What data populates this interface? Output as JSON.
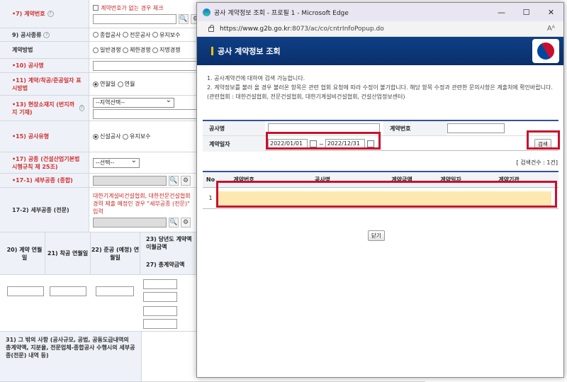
{
  "form": {
    "contract_no_label": "•7) 계약번호",
    "contract_no_chk": "계약번호가 없는 경우 체크",
    "type_label": "9) 공사종류",
    "type_opts": [
      "종합공사",
      "전문공사",
      "유지보수"
    ],
    "method_label": "계약방법",
    "method_opts": [
      "일반경쟁",
      "제한경쟁",
      "지명경쟁"
    ],
    "name_label": "•10) 공사명",
    "date_label": "•11) 계약/착공/준공일자 표시방법",
    "date_opts": [
      "연월일",
      "연월"
    ],
    "loc_label": "•13) 현장소재지 (번지까지 기재)",
    "loc_select": "--지역선택--",
    "ctype_label": "•15) 공사유형",
    "ctype_opts": [
      "신설공사",
      "유지보수"
    ],
    "work_label": "•17) 공종 (건설산업기본법 시행규칙 제 25조)",
    "work_select": "--선택--",
    "sub1_label": "•17-1) 세부공종 (종합)",
    "sub2_label": "17-2) 세부공종 (전문)",
    "sub2_note": "대한기계설비건설협회, 대한전문건설협회 경력 제출 예정인 경우 \"세부공종 (전문)\" 입력",
    "c20": "20) 계약 연월일",
    "c21": "21) 착공 연월일",
    "c22": "22) 준공 (예정) 연월일",
    "c23": "23) 당년도 계약액 이월금액",
    "c27": "27) 총계약금액",
    "c31": "31) 그 밖의 사항 (공사규모, 공법, 공동도급내역의 총계약액, 지분율, 전문업체-종합공사 수행시의 세부공종(전문) 내역 등)"
  },
  "popup": {
    "title": "공사 계약정보 조회 - 프로필 1 - Microsoft Edge",
    "url": "https://www.g2b.go.kr:8073/ac/co/cntrInfoPopup.do",
    "url_host": "https://www.g2b.go.kr",
    "url_rest": ":8073/ac/co/cntrInfoPopup.do",
    "header": "공사 계약정보 조회",
    "notice1": "1. 공사계약건에 대하여 검색 가능합니다.",
    "notice2": "2. 계약정보를 불러 올 경우 불러온 항목은 관련 협회 요청에 따라 수정이 불가합니다. 해당 항목 수정과 관련한 문의사항은 계출처에 확인바랍니다. (관련협회 : 대한건설협회, 전문건설협회, 대한기계설비건설협회, 건설산업정보센터)",
    "lbl_name": "공사명",
    "lbl_no": "계약번호",
    "lbl_date": "계약일자",
    "date_from": "2022/01/01",
    "date_to": "2022/12/31",
    "tilde": "~",
    "search_btn": "검색",
    "count": "[ 검색건수 : 1건]",
    "cols": [
      "No",
      "계약번호",
      "공사명",
      "계약금액",
      "계약일자",
      "계약기관"
    ],
    "row_no": "1",
    "close_btn": "닫기"
  },
  "colors": {
    "accent": "#0f3f86",
    "highlight": "#c8102e"
  }
}
